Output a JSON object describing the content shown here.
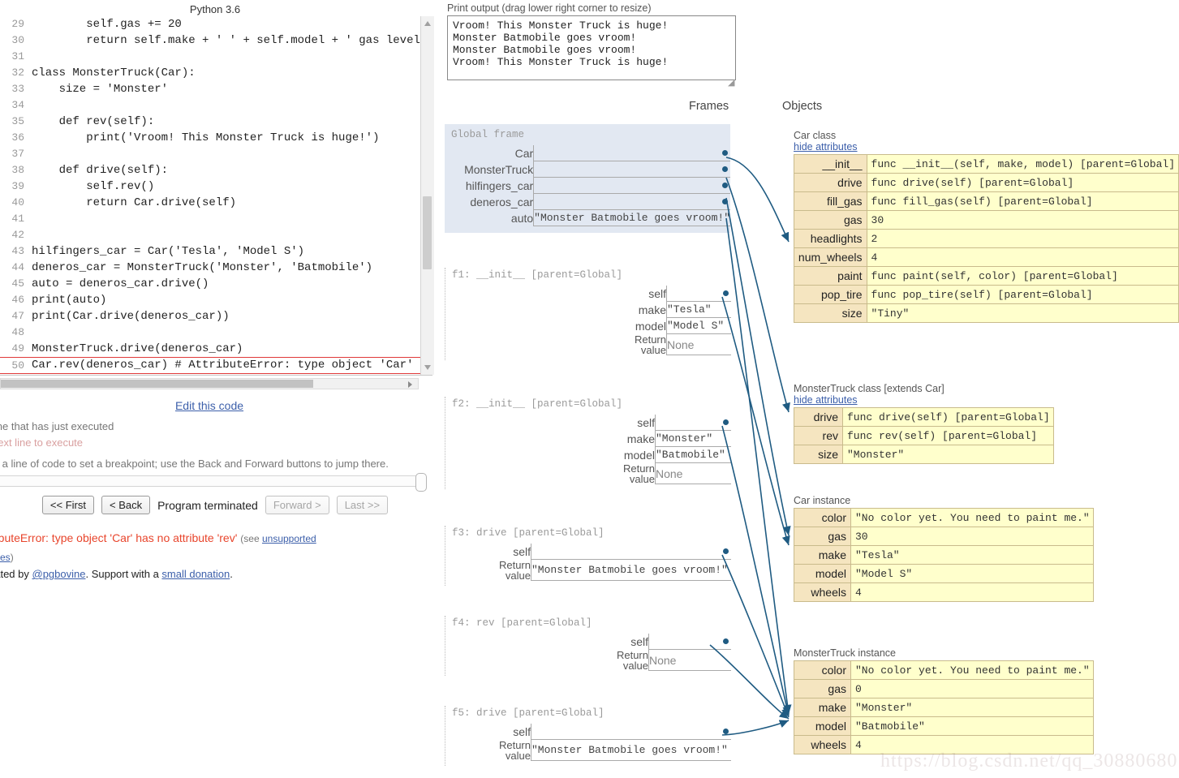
{
  "python_version": "Python 3.6",
  "code": {
    "lines": [
      {
        "num": "29",
        "text": "        self.gas += 20"
      },
      {
        "num": "30",
        "text": "        return self.make + ' ' + self.model + ' gas level:"
      },
      {
        "num": "31",
        "text": ""
      },
      {
        "num": "32",
        "text": "class MonsterTruck(Car):"
      },
      {
        "num": "33",
        "text": "    size = 'Monster'"
      },
      {
        "num": "34",
        "text": ""
      },
      {
        "num": "35",
        "text": "    def rev(self):"
      },
      {
        "num": "36",
        "text": "        print('Vroom! This Monster Truck is huge!')"
      },
      {
        "num": "37",
        "text": ""
      },
      {
        "num": "38",
        "text": "    def drive(self):"
      },
      {
        "num": "39",
        "text": "        self.rev()"
      },
      {
        "num": "40",
        "text": "        return Car.drive(self)"
      },
      {
        "num": "41",
        "text": ""
      },
      {
        "num": "42",
        "text": ""
      },
      {
        "num": "43",
        "text": "hilfingers_car = Car('Tesla', 'Model S')"
      },
      {
        "num": "44",
        "text": "deneros_car = MonsterTruck('Monster', 'Batmobile')"
      },
      {
        "num": "45",
        "text": "auto = deneros_car.drive()"
      },
      {
        "num": "46",
        "text": "print(auto)"
      },
      {
        "num": "47",
        "text": "print(Car.drive(deneros_car))"
      },
      {
        "num": "48",
        "text": ""
      },
      {
        "num": "49",
        "text": "MonsterTruck.drive(deneros_car)"
      },
      {
        "num": "50",
        "text": "Car.rev(deneros_car) # AttributeError: type object 'Car' ha:",
        "error": true
      }
    ]
  },
  "edit_link": "Edit this code",
  "legend": {
    "just_executed": "line that has just executed",
    "next_to_execute": "next line to execute",
    "breakpoint_hint": "ck a line of code to set a breakpoint; use the Back and Forward buttons to jump there."
  },
  "controls": {
    "first": "<< First",
    "back": "< Back",
    "status": "Program terminated",
    "forward": "Forward >",
    "last": "Last >>"
  },
  "error": {
    "message": "tributeError: type object 'Car' has no attribute 'rev'",
    "see_prefix": "(see ",
    "link1": "unsupported",
    "link2": "tures",
    "see_suffix": ")"
  },
  "credit": {
    "prefix": "eated by ",
    "author": "@pgbovine",
    "middle": ". Support with a ",
    "donation": "small donation",
    "suffix": "."
  },
  "print_output": {
    "label": "Print output (drag lower right corner to resize)",
    "text": "Vroom! This Monster Truck is huge!\nMonster Batmobile goes vroom!\nMonster Batmobile goes vroom!\nVroom! This Monster Truck is huge!"
  },
  "headers": {
    "frames": "Frames",
    "objects": "Objects"
  },
  "frames": [
    {
      "id": "global",
      "title": "Global frame",
      "vars": [
        {
          "name": "Car",
          "value": "",
          "pointer": true
        },
        {
          "name": "MonsterTruck",
          "value": "",
          "pointer": true
        },
        {
          "name": "hilfingers_car",
          "value": "",
          "pointer": true
        },
        {
          "name": "deneros_car",
          "value": "",
          "pointer": true
        },
        {
          "name": "auto",
          "value": "\"Monster Batmobile goes vroom!\"",
          "pointer": false
        }
      ]
    },
    {
      "id": "f1",
      "title": "f1: __init__ [parent=Global]",
      "vars": [
        {
          "name": "self",
          "value": "",
          "pointer": true
        },
        {
          "name": "make",
          "value": "\"Tesla\"",
          "pointer": false
        },
        {
          "name": "model",
          "value": "\"Model S\"",
          "pointer": false
        },
        {
          "name": "Return value",
          "value": "None",
          "pointer": false,
          "none": true
        }
      ]
    },
    {
      "id": "f2",
      "title": "f2: __init__ [parent=Global]",
      "vars": [
        {
          "name": "self",
          "value": "",
          "pointer": true
        },
        {
          "name": "make",
          "value": "\"Monster\"",
          "pointer": false
        },
        {
          "name": "model",
          "value": "\"Batmobile\"",
          "pointer": false
        },
        {
          "name": "Return value",
          "value": "None",
          "pointer": false,
          "none": true
        }
      ]
    },
    {
      "id": "f3",
      "title": "f3: drive [parent=Global]",
      "vars": [
        {
          "name": "self",
          "value": "",
          "pointer": true
        },
        {
          "name": "Return value",
          "value": "\"Monster Batmobile goes vroom!\"",
          "pointer": false
        }
      ]
    },
    {
      "id": "f4",
      "title": "f4: rev [parent=Global]",
      "vars": [
        {
          "name": "self",
          "value": "",
          "pointer": true
        },
        {
          "name": "Return value",
          "value": "None",
          "pointer": false,
          "none": true
        }
      ]
    },
    {
      "id": "f5",
      "title": "f5: drive [parent=Global]",
      "vars": [
        {
          "name": "self",
          "value": "",
          "pointer": true
        },
        {
          "name": "Return value",
          "value": "\"Monster Batmobile goes vroom!\"",
          "pointer": false
        }
      ]
    }
  ],
  "objects": [
    {
      "id": "car-class",
      "label": "Car class",
      "toggle": "hide attributes",
      "rows": [
        {
          "k": "__init__",
          "v": "func __init__(self, make, model) [parent=Global]"
        },
        {
          "k": "drive",
          "v": "func drive(self) [parent=Global]"
        },
        {
          "k": "fill_gas",
          "v": "func fill_gas(self) [parent=Global]"
        },
        {
          "k": "gas",
          "v": "30"
        },
        {
          "k": "headlights",
          "v": "2"
        },
        {
          "k": "num_wheels",
          "v": "4"
        },
        {
          "k": "paint",
          "v": "func paint(self, color) [parent=Global]"
        },
        {
          "k": "pop_tire",
          "v": "func pop_tire(self) [parent=Global]"
        },
        {
          "k": "size",
          "v": "\"Tiny\""
        }
      ]
    },
    {
      "id": "monstertruck-class",
      "label": "MonsterTruck class [extends Car]",
      "toggle": "hide attributes",
      "rows": [
        {
          "k": "drive",
          "v": "func drive(self) [parent=Global]"
        },
        {
          "k": "rev",
          "v": "func rev(self) [parent=Global]"
        },
        {
          "k": "size",
          "v": "\"Monster\""
        }
      ]
    },
    {
      "id": "car-instance",
      "label": "Car instance",
      "toggle": "",
      "rows": [
        {
          "k": "color",
          "v": "\"No color yet. You need to paint me.\""
        },
        {
          "k": "gas",
          "v": "30"
        },
        {
          "k": "make",
          "v": "\"Tesla\""
        },
        {
          "k": "model",
          "v": "\"Model S\""
        },
        {
          "k": "wheels",
          "v": "4"
        }
      ]
    },
    {
      "id": "monstertruck-instance",
      "label": "MonsterTruck instance",
      "toggle": "",
      "rows": [
        {
          "k": "color",
          "v": "\"No color yet. You need to paint me.\""
        },
        {
          "k": "gas",
          "v": "0"
        },
        {
          "k": "make",
          "v": "\"Monster\""
        },
        {
          "k": "model",
          "v": "\"Batmobile\""
        },
        {
          "k": "wheels",
          "v": "4"
        }
      ]
    }
  ],
  "watermark": "https://blog.csdn.net/qq_30880680",
  "colors": {
    "global_frame_bg": "#e2e8f2",
    "object_value_bg": "#ffffcc",
    "object_key_bg": "#f5e5c0",
    "object_border": "#c9bb8c",
    "arrow": "#1f5b82",
    "error_red": "#e8452c",
    "link_blue": "#3c5faa"
  }
}
